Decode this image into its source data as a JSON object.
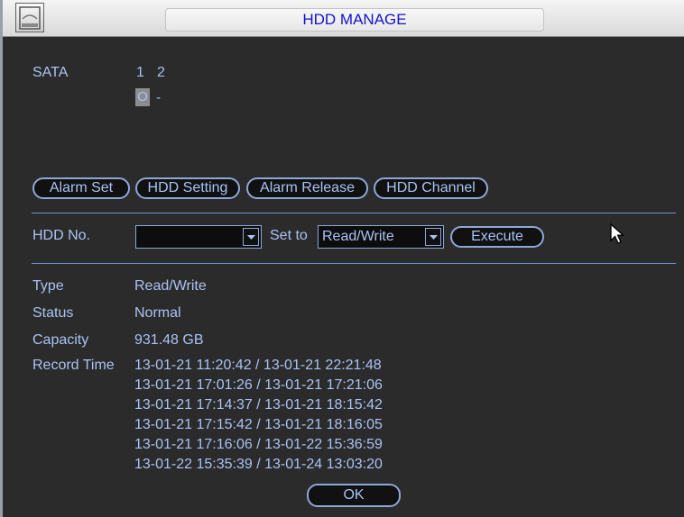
{
  "window": {
    "title": "HDD MANAGE"
  },
  "sata": {
    "label": "SATA",
    "ports": [
      "1",
      "2"
    ],
    "states": [
      "O",
      "-"
    ]
  },
  "tabs": [
    "Alarm Set",
    "HDD Setting",
    "Alarm Release",
    "HDD Channel"
  ],
  "controls": {
    "hdd_no_label": "HDD No.",
    "hdd_no_value": "",
    "set_to_label": "Set to",
    "set_to_value": "Read/Write",
    "execute_label": "Execute"
  },
  "info": {
    "type_label": "Type",
    "type_value": "Read/Write",
    "status_label": "Status",
    "status_value": "Normal",
    "capacity_label": "Capacity",
    "capacity_value": "931.48 GB",
    "record_time_label": "Record Time",
    "record_times": [
      "13-01-21 11:20:42 / 13-01-21 22:21:48",
      "13-01-21 17:01:26 / 13-01-21 17:21:06",
      "13-01-21 17:14:37 / 13-01-21 18:15:42",
      "13-01-21 17:15:42 / 13-01-21 18:16:05",
      "13-01-21 17:16:06 / 13-01-22 15:36:59",
      "13-01-22 15:35:39 / 13-01-24 13:03:20"
    ]
  },
  "footer": {
    "ok_label": "OK"
  },
  "icons": {
    "title_icon": "hdd-icon",
    "dropdown_arrow": "chevron-down-icon",
    "pointer": "mouse-cursor-icon"
  },
  "colors": {
    "title_text": "#1313c9",
    "body_text": "#a9c3f4",
    "background": "#2b2b2b",
    "accent_border": "#8fa7d8"
  }
}
